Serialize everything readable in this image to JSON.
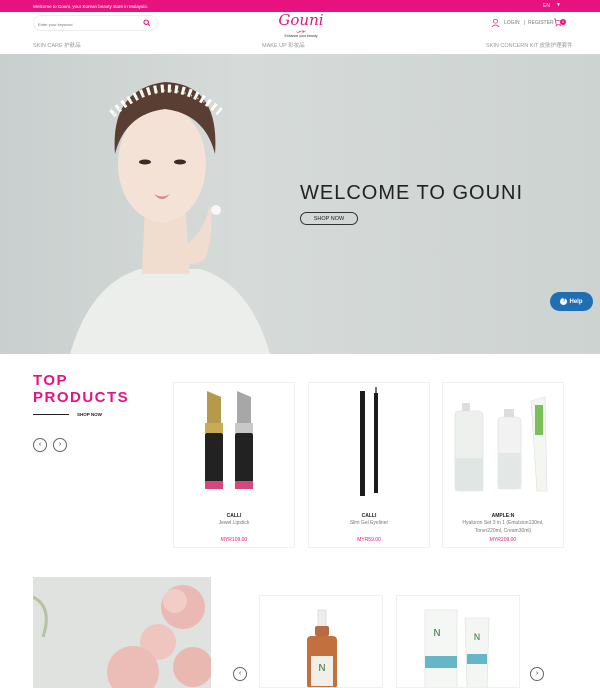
{
  "topbar": {
    "message": "Welcome to Gouni, your Korean beauty store in Malaysia.",
    "language": "EN",
    "caret": "▼"
  },
  "header": {
    "search_placeholder": "Enter your keyword",
    "logo": {
      "name": "Gouni",
      "script": "بوني",
      "tagline": "Enhance your beauty"
    },
    "login": "LOGIN",
    "separator": "|",
    "register": "REGISTER",
    "cart_count": "0"
  },
  "nav": {
    "skin_care": "SKIN CARE 护肤品",
    "make_up": "MAKE UP 彩妆品",
    "skin_concern": "SKIN CONCERN KIT 皮肤护理套件"
  },
  "hero": {
    "title": "WELCOME TO GOUNI",
    "button": "SHOP NOW"
  },
  "help": {
    "icon": "?",
    "label": "Help"
  },
  "top_products": {
    "title_line1": "TOP",
    "title_line2": "PRODUCTS",
    "shop_now": "SHOP NOW",
    "prev": "‹",
    "next": "›",
    "products": [
      {
        "brand": "CALLI",
        "name": "Jewel Lipstick",
        "price": "MYR109.00"
      },
      {
        "brand": "CALLI",
        "name": "Slim Gel Eyeliner",
        "price": "MYR59.00"
      },
      {
        "brand": "AMPLE:N",
        "name": "Hyaluron Set 3 in 1 (Emulsion130ml, Toner220ml, Cream30ml)",
        "price": "MYR209.00"
      }
    ]
  },
  "second_row": {
    "prev": "‹",
    "next": "›"
  },
  "colors": {
    "accent": "#e6137f",
    "help": "#1f6fb5"
  }
}
